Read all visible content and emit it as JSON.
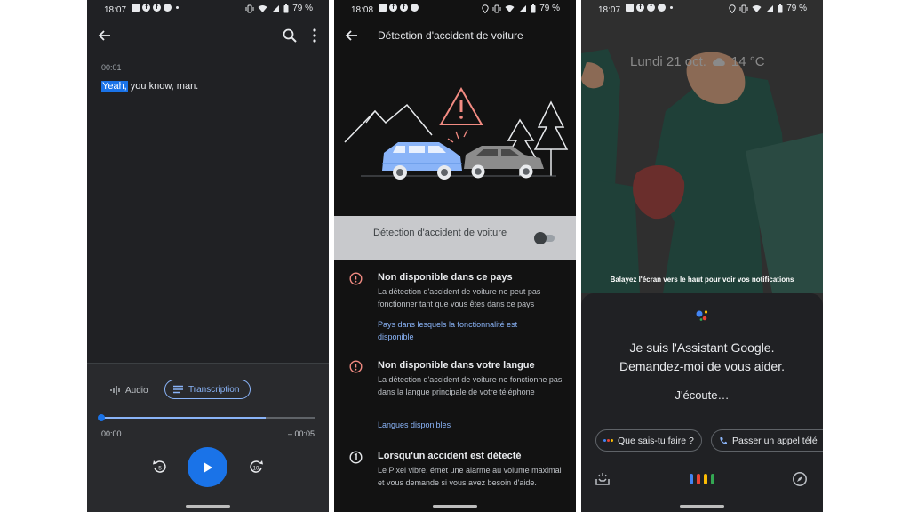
{
  "phones": {
    "recorder": {
      "status": {
        "time": "18:07",
        "battery": "79 %"
      },
      "timestamp": "00:01",
      "transcript_highlight": "Yeah,",
      "transcript_rest": " you know, man.",
      "tabs": {
        "audio": "Audio",
        "transcription": "Transcription",
        "active": "transcription"
      },
      "playback": {
        "current": "00:00",
        "remaining": "– 00:05",
        "progress": 0,
        "rewind_seconds": "5",
        "forward_seconds": "10"
      }
    },
    "safety": {
      "status": {
        "time": "18:08",
        "battery": "79 %"
      },
      "title": "Détection d'accident de voiture",
      "toggle": {
        "label": "Détection d'accident de voiture",
        "on": false
      },
      "sections": [
        {
          "title": "Non disponible dans ce pays",
          "body": "La détection d'accident de voiture ne peut pas fonctionner tant que vous êtes dans ce pays",
          "link": "Pays dans lesquels la fonctionnalité est disponible"
        },
        {
          "title": "Non disponible dans votre langue",
          "body": "La détection d'accident de voiture ne fonctionne pas dans la langue principale de votre téléphone",
          "link": "Langues disponibles"
        },
        {
          "title": "Lorsqu'un accident est détecté",
          "body": "Le Pixel vibre, émet une alarme au volume maximal et vous demande si vous avez besoin d'aide."
        }
      ]
    },
    "assistant": {
      "status": {
        "time": "18:07",
        "battery": "79 %"
      },
      "date": "Lundi 21 oct.",
      "temperature": "14 °C",
      "swipe_hint": "Balayez l'écran vers le haut pour voir vos notifications",
      "greeting_line1": "Je suis l'Assistant Google.",
      "greeting_line2": "Demandez-moi de vous aider.",
      "listening": "J'écoute…",
      "chips": [
        "Que sais-tu faire ?",
        "Passer un appel télé"
      ]
    }
  },
  "colors": {
    "accent": "#1a73e8",
    "accent_light": "#8ab4f8",
    "warning": "#f28b82",
    "google_blue": "#4285f4",
    "google_red": "#ea4335",
    "google_yellow": "#fbbc04",
    "google_green": "#34a853"
  },
  "icons": {
    "notification_icons": [
      "news-icon",
      "facebook-icon",
      "facebook-icon",
      "messenger-icon"
    ],
    "status_right": [
      "location-icon",
      "vibrate-icon",
      "wifi-icon",
      "signal-icon",
      "battery-icon"
    ]
  }
}
